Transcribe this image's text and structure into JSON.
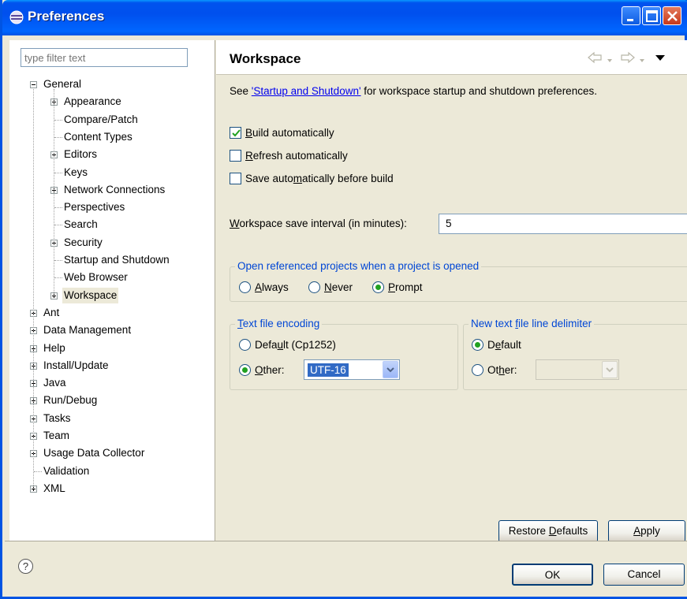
{
  "window": {
    "title": "Preferences"
  },
  "filter": {
    "placeholder": "type filter text"
  },
  "tree": {
    "items": [
      {
        "label": "General",
        "level": 0,
        "expander": "minus"
      },
      {
        "label": "Appearance",
        "level": 1,
        "expander": "plus"
      },
      {
        "label": "Compare/Patch",
        "level": 1,
        "expander": "none"
      },
      {
        "label": "Content Types",
        "level": 1,
        "expander": "none"
      },
      {
        "label": "Editors",
        "level": 1,
        "expander": "plus"
      },
      {
        "label": "Keys",
        "level": 1,
        "expander": "none"
      },
      {
        "label": "Network Connections",
        "level": 1,
        "expander": "plus"
      },
      {
        "label": "Perspectives",
        "level": 1,
        "expander": "none"
      },
      {
        "label": "Search",
        "level": 1,
        "expander": "none"
      },
      {
        "label": "Security",
        "level": 1,
        "expander": "plus"
      },
      {
        "label": "Startup and Shutdown",
        "level": 1,
        "expander": "none"
      },
      {
        "label": "Web Browser",
        "level": 1,
        "expander": "none"
      },
      {
        "label": "Workspace",
        "level": 1,
        "expander": "plus",
        "selected": true
      },
      {
        "label": "Ant",
        "level": 0,
        "expander": "plus"
      },
      {
        "label": "Data Management",
        "level": 0,
        "expander": "plus"
      },
      {
        "label": "Help",
        "level": 0,
        "expander": "plus"
      },
      {
        "label": "Install/Update",
        "level": 0,
        "expander": "plus"
      },
      {
        "label": "Java",
        "level": 0,
        "expander": "plus"
      },
      {
        "label": "Run/Debug",
        "level": 0,
        "expander": "plus"
      },
      {
        "label": "Tasks",
        "level": 0,
        "expander": "plus"
      },
      {
        "label": "Team",
        "level": 0,
        "expander": "plus"
      },
      {
        "label": "Usage Data Collector",
        "level": 0,
        "expander": "plus"
      },
      {
        "label": "Validation",
        "level": 0,
        "expander": "none"
      },
      {
        "label": "XML",
        "level": 0,
        "expander": "plus"
      }
    ]
  },
  "page": {
    "title": "Workspace",
    "desc_prefix": "See ",
    "desc_link": "'Startup and Shutdown'",
    "desc_suffix": " for workspace startup and shutdown preferences."
  },
  "options": {
    "build_auto": {
      "pre": "",
      "mn": "B",
      "post": "uild automatically",
      "checked": true
    },
    "refresh_auto": {
      "pre": "",
      "mn": "R",
      "post": "efresh automatically",
      "checked": false
    },
    "save_auto": {
      "pre": "Save auto",
      "mn": "m",
      "post": "atically before build",
      "checked": false
    }
  },
  "interval": {
    "label_pre": "",
    "label_mn": "W",
    "label_post": "orkspace save interval (in minutes):",
    "value": "5"
  },
  "open_projects": {
    "title": "Open referenced projects when a project is opened",
    "always": {
      "mn": "A",
      "post": "lways"
    },
    "never": {
      "mn": "N",
      "post": "ever"
    },
    "prompt": {
      "mn": "P",
      "post": "rompt"
    },
    "selected": "prompt"
  },
  "encoding": {
    "title_mn": "T",
    "title_post": "ext file encoding",
    "default_pre": "Defa",
    "default_mn": "u",
    "default_post": "lt (Cp1252)",
    "other_mn": "O",
    "other_post": "ther:",
    "other_value": "UTF-16",
    "selected": "other"
  },
  "delimiter": {
    "title_pre": "New text ",
    "title_mn": "f",
    "title_post": "ile line delimiter",
    "default_pre": "D",
    "default_mn": "e",
    "default_post": "fault",
    "other_pre": "Ot",
    "other_mn": "h",
    "other_post": "er:",
    "selected": "default"
  },
  "buttons": {
    "restore_pre": "Restore ",
    "restore_mn": "D",
    "restore_post": "efaults",
    "apply_mn": "A",
    "apply_post": "pply",
    "ok": "OK",
    "cancel": "Cancel"
  },
  "colors": {
    "title_bar": "#0054e3",
    "group_title": "#0046d5",
    "link": "#0000ee",
    "radio_dot": "#21a121",
    "selection": "#316ac5"
  }
}
